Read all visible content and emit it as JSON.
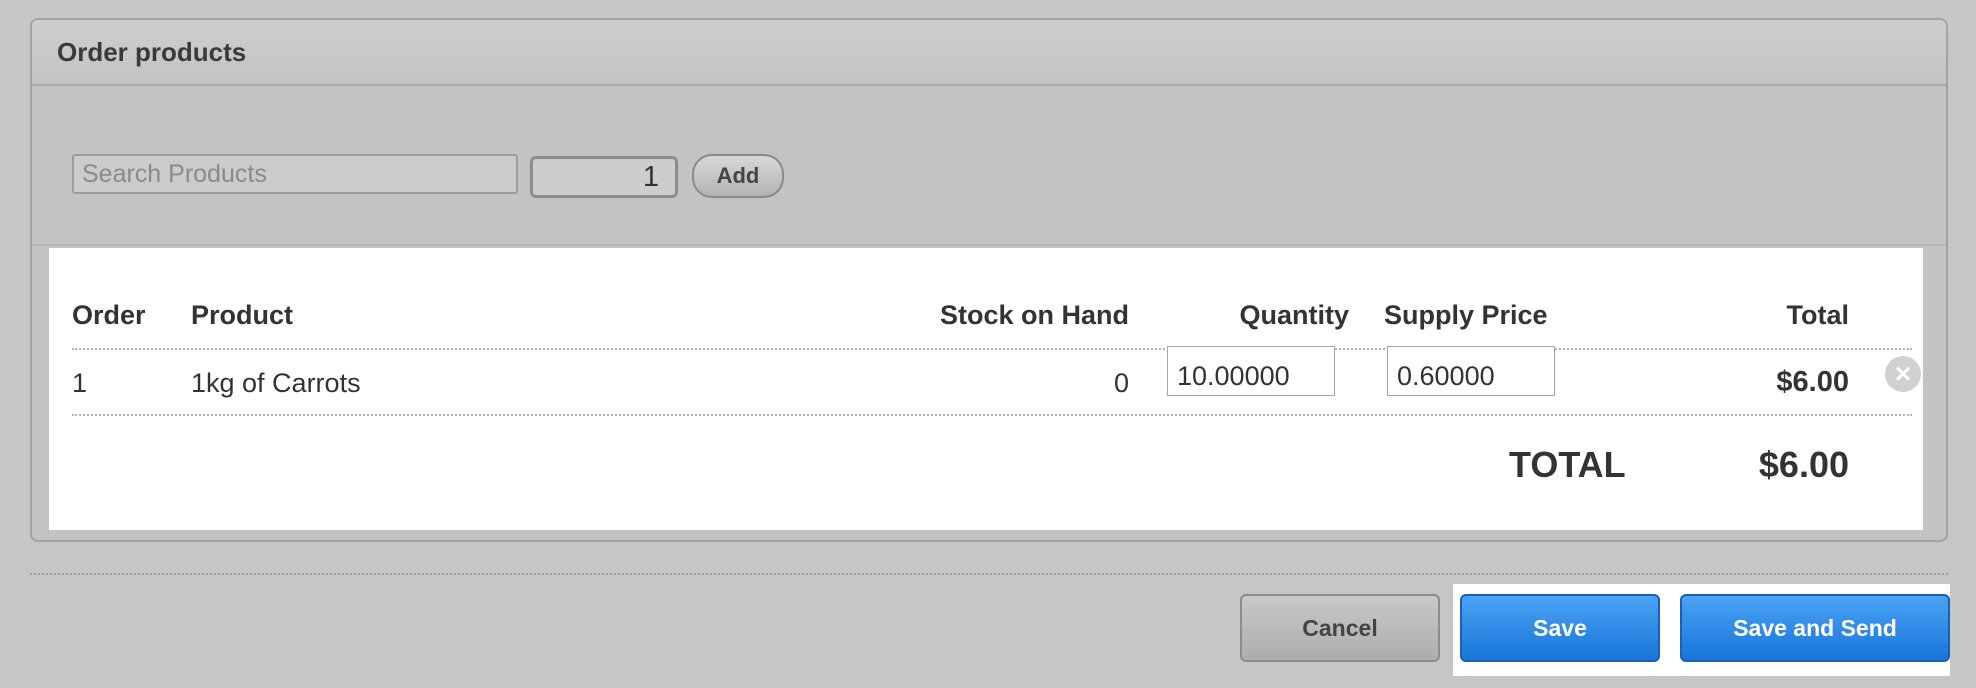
{
  "panel": {
    "title": "Order products"
  },
  "search": {
    "placeholder": "Search Products",
    "quantity": "1",
    "add_label": "Add"
  },
  "table": {
    "headers": {
      "order": "Order",
      "product": "Product",
      "stock": "Stock on Hand",
      "quantity": "Quantity",
      "supply_price": "Supply Price",
      "total": "Total"
    },
    "rows": [
      {
        "order": "1",
        "product": "1kg of Carrots",
        "stock": "0",
        "quantity": "10.00000",
        "supply_price": "0.60000",
        "total": "$6.00"
      }
    ],
    "grand_total_label": "TOTAL",
    "grand_total_value": "$6.00"
  },
  "actions": {
    "cancel": "Cancel",
    "save": "Save",
    "save_and_send": "Save and Send"
  },
  "icons": {
    "remove": "close-circle-icon"
  },
  "colors": {
    "primary": "#1875d9",
    "background": "#c6c6c6"
  }
}
